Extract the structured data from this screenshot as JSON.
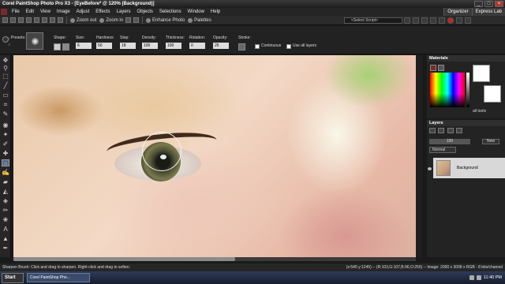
{
  "window": {
    "title": "Corel PaintShop Photo Pro X3 - [EyeBefore* @ 120% (Background)]"
  },
  "menu": [
    "File",
    "Edit",
    "View",
    "Image",
    "Adjust",
    "Effects",
    "Layers",
    "Objects",
    "Selections",
    "Window",
    "Help"
  ],
  "menubar_right": {
    "organizer": "Organizer",
    "express_lab": "Express Lab"
  },
  "toolbar": {
    "zoom_out": "Zoom out",
    "zoom_in": "Zoom in",
    "enhance": "Enhance Photo",
    "palettes": "Palettes",
    "script_select": "<Select Script>"
  },
  "tool_options": {
    "presets": "Presets:",
    "shape": "Shape:",
    "size": "Size:",
    "size_val": "6",
    "hardness": "Hardness:",
    "hardness_val": "50",
    "step": "Step:",
    "step_val": "18",
    "density": "Density:",
    "density_val": "100",
    "thickness": "Thickness:",
    "thickness_val": "100",
    "rotation": "Rotation:",
    "rotation_val": "0",
    "opacity": "Opacity:",
    "opacity_val": "26",
    "stroke": "Stroke:",
    "continuous": "Continuous",
    "use_all_layers": "Use all layers"
  },
  "materials": {
    "title": "Materials",
    "all_tools": "all tools"
  },
  "layers": {
    "title": "Layers",
    "opacity": "100",
    "new": "New",
    "blend": "Normal",
    "layer_name": "Background"
  },
  "status": {
    "left": "Sharpen Brush: Click and drag to sharpen. Right-click and drag to soften.",
    "right": "(x:545 y:1245) -- (R:103,G:107,B:96,O:255) -- Image: 2000 x 3008 x RGB - 8 bits/channel"
  },
  "taskbar": {
    "start": "Start",
    "task": "Corel PaintShop Pho...",
    "clock": "11:40 PM"
  },
  "colors": {
    "accent": "#5a6a80",
    "brand_red": "#b8342a"
  },
  "scrollbar": {
    "horizontal_visible_fraction": 0.55
  }
}
